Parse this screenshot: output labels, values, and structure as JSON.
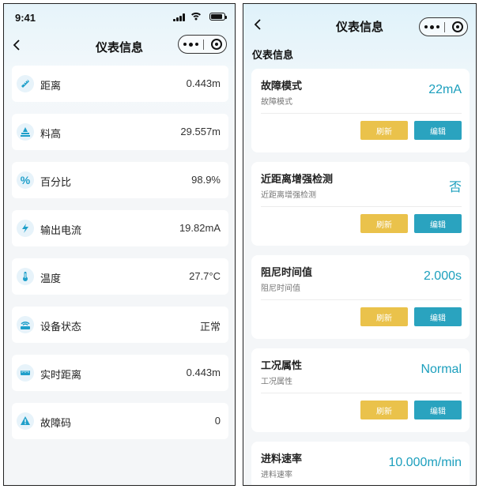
{
  "left": {
    "status_time": "9:41",
    "nav_title": "仪表信息",
    "items": [
      {
        "label": "距离",
        "value": "0.443m",
        "icon": "ruler-icon"
      },
      {
        "label": "料高",
        "value": "29.557m",
        "icon": "level-icon"
      },
      {
        "label": "百分比",
        "value": "98.9%",
        "icon": "percent-icon"
      },
      {
        "label": "输出电流",
        "value": "19.82mA",
        "icon": "lightning-icon"
      },
      {
        "label": "温度",
        "value": "27.7°C",
        "icon": "thermometer-icon"
      },
      {
        "label": "设备状态",
        "value": "正常",
        "icon": "device-status-icon"
      },
      {
        "label": "实时距离",
        "value": "0.443m",
        "icon": "realtime-distance-icon"
      },
      {
        "label": "故障码",
        "value": "0",
        "icon": "warning-icon"
      }
    ]
  },
  "right": {
    "nav_title": "仪表信息",
    "section_title": "仪表信息",
    "refresh_label": "刷新",
    "edit_label": "编辑",
    "cards": [
      {
        "title": "故障模式",
        "subtitle": "故障模式",
        "value": "22mA"
      },
      {
        "title": "近距离增强检测",
        "subtitle": "近距离增强检测",
        "value": "否"
      },
      {
        "title": "阻尼时间值",
        "subtitle": "阻尼时间值",
        "value": "2.000s"
      },
      {
        "title": "工况属性",
        "subtitle": "工况属性",
        "value": "Normal"
      },
      {
        "title": "进料速率",
        "subtitle": "进料速率",
        "value": "10.000m/min"
      }
    ]
  },
  "colors": {
    "accent": "#1c9fbd",
    "refresh": "#eac24b",
    "edit": "#2aa3bf"
  }
}
